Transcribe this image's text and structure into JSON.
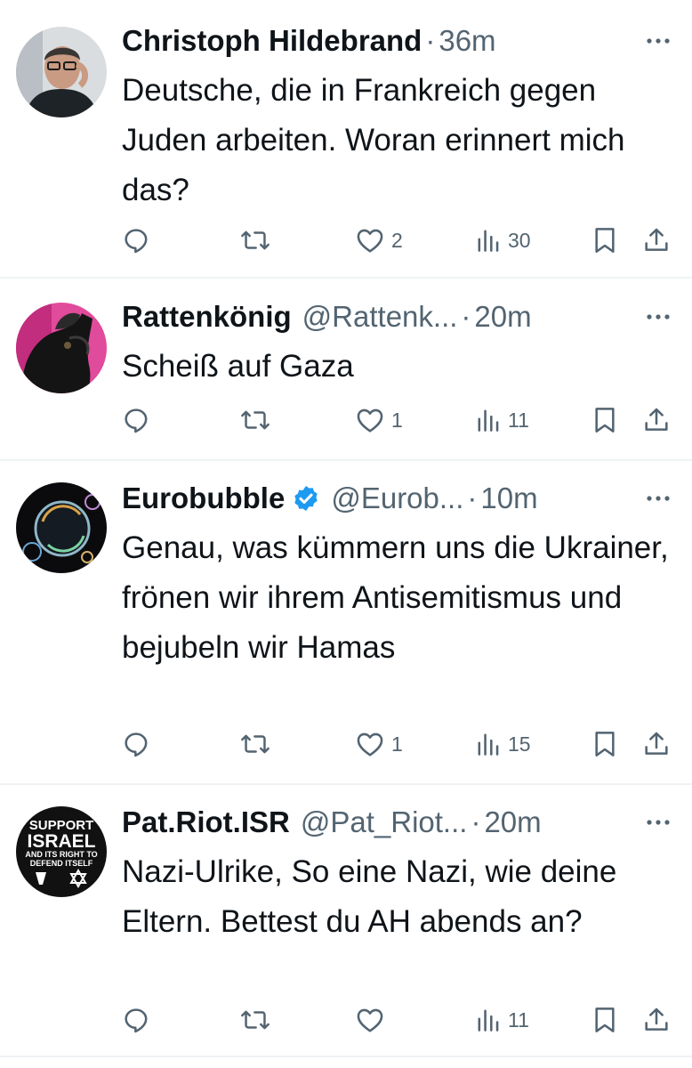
{
  "tweets": [
    {
      "name": "Christoph Hildebrand",
      "handle": "",
      "sep": "·",
      "time": "36m",
      "text": "Deutsche, die in Frankreich gegen Juden arbeiten. Woran erinnert mich das?",
      "likes": "2",
      "views": "30",
      "verified": false,
      "avatar": "portrait-man-glasses"
    },
    {
      "name": "Rattenkönig",
      "handle": "@Rattenk...",
      "sep": "·",
      "time": "20m",
      "text": "Scheiß auf Gaza",
      "likes": "1",
      "views": "11",
      "verified": false,
      "avatar": "black-dog-pink"
    },
    {
      "name": "Eurobubble",
      "handle": "@Eurob...",
      "sep": "·",
      "time": "10m",
      "text": "Genau, was kümmern uns die Ukrainer, frönen wir ihrem Antisemitismus und bejubeln wir Hamas",
      "likes": "1",
      "views": "15",
      "verified": true,
      "avatar": "soap-bubbles"
    },
    {
      "name": "Pat.Riot.ISR",
      "handle": "@Pat_Riot...",
      "sep": "·",
      "time": "20m",
      "text": "Nazi-Ulrike, So eine Nazi, wie deine Eltern.  Bettest du AH abends an?",
      "likes": "",
      "views": "11",
      "verified": false,
      "avatar": "support-israel-badge",
      "avatar_text": [
        "SUPPORT",
        "ISRAEL",
        "AND ITS RIGHT TO",
        "DEFEND ITSELF"
      ]
    }
  ],
  "colors": {
    "text": "#0f1419",
    "secondary": "#536471",
    "verified": "#1d9bf0",
    "divider": "#eff3f4"
  },
  "icons": [
    "reply-icon",
    "retweet-icon",
    "like-icon",
    "views-icon",
    "bookmark-icon",
    "share-icon",
    "more-icon",
    "verified-icon"
  ]
}
